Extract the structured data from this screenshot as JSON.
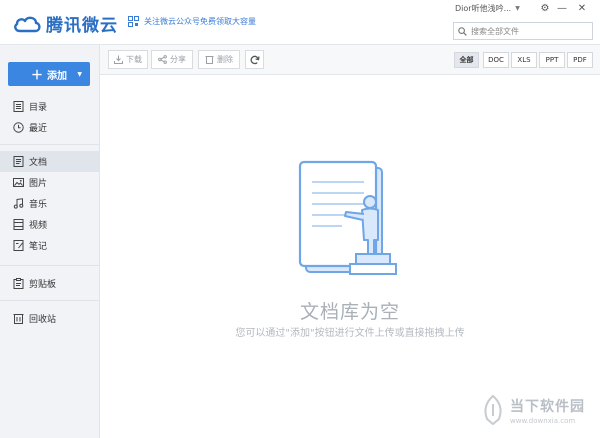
{
  "app": {
    "logo_text": "腾讯微云",
    "promo_text": "关注微云公众号免费领取大容量",
    "user_name": "Dior听他浅吟...",
    "search_placeholder": "搜索全部文件"
  },
  "sidebar": {
    "add_label": "添加",
    "groups": [
      [
        {
          "label": "目录",
          "icon": "list-icon"
        },
        {
          "label": "最近",
          "icon": "clock-icon"
        }
      ],
      [
        {
          "label": "文档",
          "icon": "document-icon"
        },
        {
          "label": "图片",
          "icon": "image-icon"
        },
        {
          "label": "音乐",
          "icon": "music-icon"
        },
        {
          "label": "视频",
          "icon": "video-icon"
        },
        {
          "label": "笔记",
          "icon": "note-icon"
        }
      ],
      [
        {
          "label": "剪贴板",
          "icon": "clipboard-icon"
        }
      ],
      [
        {
          "label": "回收站",
          "icon": "trash-icon"
        }
      ]
    ],
    "active": "文档"
  },
  "toolbar": {
    "download_label": "下载",
    "share_label": "分享",
    "delete_label": "删除",
    "filters": [
      "全部",
      "DOC",
      "XLS",
      "PPT",
      "PDF"
    ],
    "active_filter": "全部"
  },
  "empty_state": {
    "title": "文档库为空",
    "description": "您可以通过\"添加\"按钮进行文件上传或直接拖拽上传"
  },
  "watermark": {
    "name": "当下软件园",
    "url": "www.downxia.com"
  },
  "colors": {
    "accent": "#3a86e0",
    "brand": "#2a6fc4",
    "sidebar_bg": "#f1f3f6",
    "active_item_bg": "#e0e5ec"
  }
}
